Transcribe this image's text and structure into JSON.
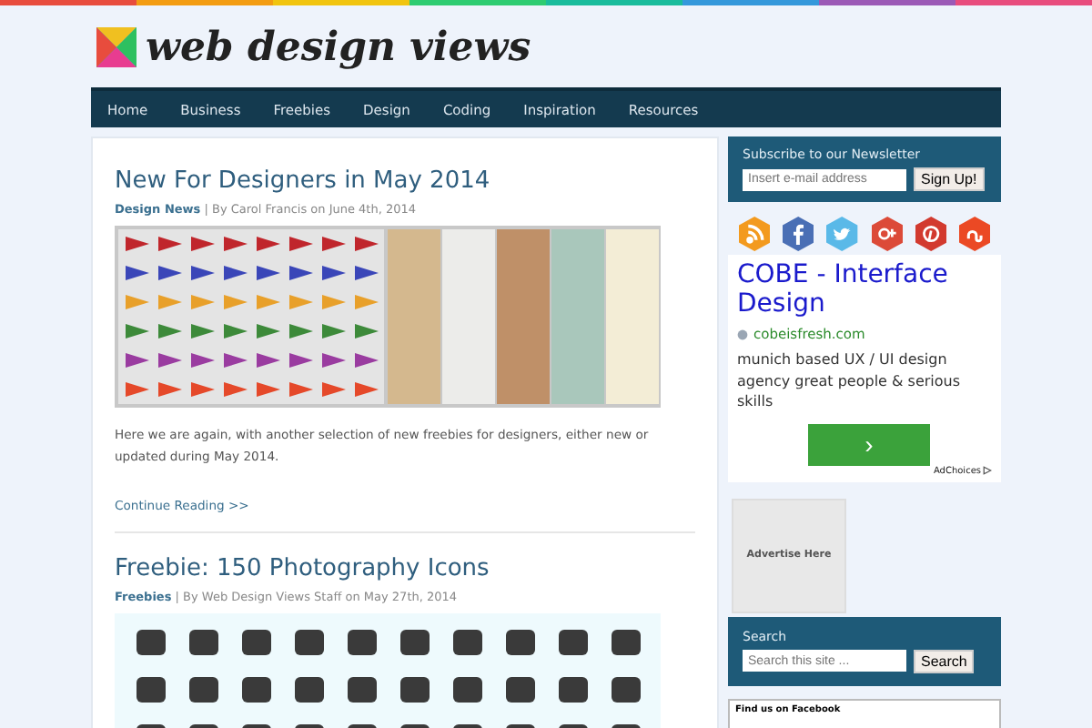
{
  "logo": {
    "text": "web design views"
  },
  "nav": [
    {
      "label": "Home"
    },
    {
      "label": "Business"
    },
    {
      "label": "Freebies"
    },
    {
      "label": "Design"
    },
    {
      "label": "Coding"
    },
    {
      "label": "Inspiration"
    },
    {
      "label": "Resources"
    }
  ],
  "posts": [
    {
      "title": "New For Designers in May 2014",
      "category": "Design News",
      "byline": "| By Carol Francis on June 4th, 2014",
      "excerpt": "Here we are again, with another selection of new freebies for designers, either new or updated during May 2014.",
      "more": "Continue Reading >>"
    },
    {
      "title": "Freebie: 150 Photography Icons",
      "category": "Freebies",
      "byline": "| By Web Design Views Staff on May 27th, 2014"
    }
  ],
  "newsletter": {
    "title": "Subscribe to our Newsletter",
    "placeholder": "Insert e-mail address",
    "button": "Sign Up!"
  },
  "social": [
    {
      "kind": "rss",
      "color": "#f39a1e"
    },
    {
      "kind": "facebook",
      "color": "#4a6fb5"
    },
    {
      "kind": "twitter",
      "color": "#5ab9e8"
    },
    {
      "kind": "googleplus",
      "color": "#dc4a38"
    },
    {
      "kind": "pinterest",
      "color": "#d23a2f"
    },
    {
      "kind": "stumbleupon",
      "color": "#eb4924"
    }
  ],
  "ad": {
    "title": "COBE - Interface Design",
    "url": "cobeisfresh.com",
    "text": "munich based UX / UI design agency great people & serious skills",
    "button": "›",
    "choices": "AdChoices"
  },
  "advertise": "Advertise Here",
  "search": {
    "title": "Search",
    "placeholder": "Search this site ...",
    "button": "Search"
  },
  "facebook": {
    "title": "Find us on Facebook"
  }
}
